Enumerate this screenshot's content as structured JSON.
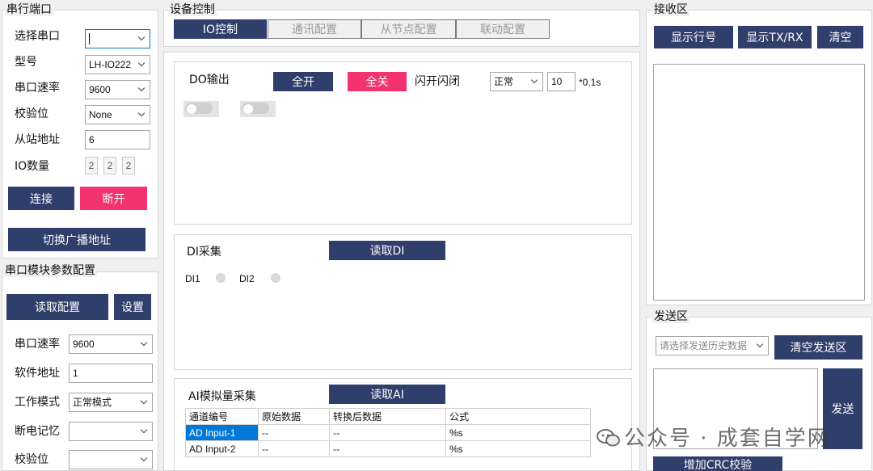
{
  "serial_port": {
    "title": "串行端口",
    "select_port_label": "选择串口",
    "select_port_value": "",
    "model_label": "型号",
    "model_value": "LH-IO222",
    "baud_label": "串口速率",
    "baud_value": "9600",
    "parity_label": "校验位",
    "parity_value": "None",
    "slave_label": "从站地址",
    "slave_value": "6",
    "io_count_label": "IO数量",
    "io_counts": [
      "2",
      "2",
      "2"
    ],
    "connect_label": "连接",
    "disconnect_label": "断开",
    "broadcast_label": "切换广播地址"
  },
  "module_config": {
    "title": "串口模块参数配置",
    "read_label": "读取配置",
    "set_label": "设置",
    "baud_label": "串口速率",
    "baud_value": "9600",
    "soft_addr_label": "软件地址",
    "soft_addr_value": "1",
    "work_mode_label": "工作模式",
    "work_mode_value": "正常模式",
    "power_mem_label": "断电记忆",
    "power_mem_value": "",
    "parity_label": "校验位",
    "parity_value": ""
  },
  "device_control": {
    "title": "设备控制",
    "tabs": [
      "IO控制",
      "通讯配置",
      "从节点配置",
      "联动配置"
    ],
    "do": {
      "label": "DO输出",
      "all_on": "全开",
      "all_off": "全关",
      "flash_label": "闪开闪闭",
      "mode_value": "正常",
      "interval_value": "10",
      "unit": "*0.1s"
    },
    "di": {
      "label": "DI采集",
      "read_label": "读取DI",
      "inputs": [
        "DI1",
        "DI2"
      ]
    },
    "ai": {
      "label": "AI模拟量采集",
      "read_label": "读取AI",
      "columns": [
        "通道编号",
        "原始数据",
        "转换后数据",
        "公式"
      ],
      "rows": [
        [
          "AD Input-1",
          "--",
          "--",
          "%s"
        ],
        [
          "AD Input-2",
          "--",
          "--",
          "%s"
        ]
      ]
    }
  },
  "receive": {
    "title": "接收区",
    "show_line_label": "显示行号",
    "show_txrx_label": "显示TX/RX",
    "clear_label": "清空"
  },
  "send": {
    "title": "发送区",
    "history_placeholder": "请选择发送历史数据",
    "clear_send_label": "清空发送区",
    "send_label": "发送",
    "crc_label": "增加CRC校验"
  },
  "watermark": {
    "text": "公众号 · 成套自学网"
  },
  "colors": {
    "navy": "#2f3e6a",
    "pink": "#f3336f",
    "selection": "#0078d7"
  }
}
